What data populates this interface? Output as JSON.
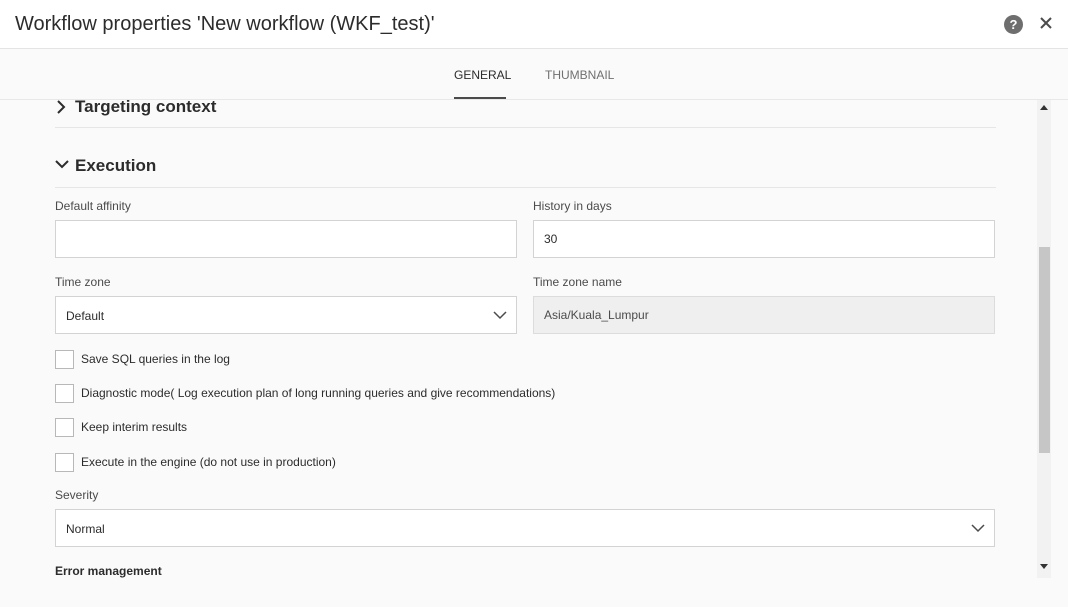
{
  "dialog": {
    "title": "Workflow properties 'New workflow (WKF_test)'",
    "help_glyph": "?",
    "help_icon": "help-circle-icon",
    "close_icon": "close-icon"
  },
  "tabs": [
    {
      "label": "GENERAL",
      "active": true
    },
    {
      "label": "THUMBNAIL",
      "active": false
    }
  ],
  "sections": {
    "targeting_context": {
      "label": "Targeting context",
      "expanded": false,
      "icon": "chevron-right-icon"
    },
    "execution": {
      "label": "Execution",
      "expanded": true,
      "icon": "chevron-down-icon"
    }
  },
  "fields": {
    "default_affinity": {
      "label": "Default affinity",
      "value": ""
    },
    "history_in_days": {
      "label": "History in days",
      "value": "30"
    },
    "time_zone": {
      "label": "Time zone",
      "value": "Default"
    },
    "time_zone_name": {
      "label": "Time zone name",
      "value": "Asia/Kuala_Lumpur"
    },
    "severity": {
      "label": "Severity",
      "value": "Normal"
    }
  },
  "checkboxes": [
    {
      "label": "Save SQL queries in the log",
      "checked": false
    },
    {
      "label": "Diagnostic mode( Log execution plan of long running queries and give recommendations)",
      "checked": false
    },
    {
      "label": "Keep interim results",
      "checked": false
    },
    {
      "label": "Execute in the engine (do not use in production)",
      "checked": false
    }
  ],
  "error_management": {
    "label": "Error management"
  },
  "colors": {
    "background": "#fafafa",
    "header": "#ffffff",
    "text": "#2c2c2c",
    "readonly_field": "#efefef",
    "scroll_thumb": "#c6c6c6"
  }
}
